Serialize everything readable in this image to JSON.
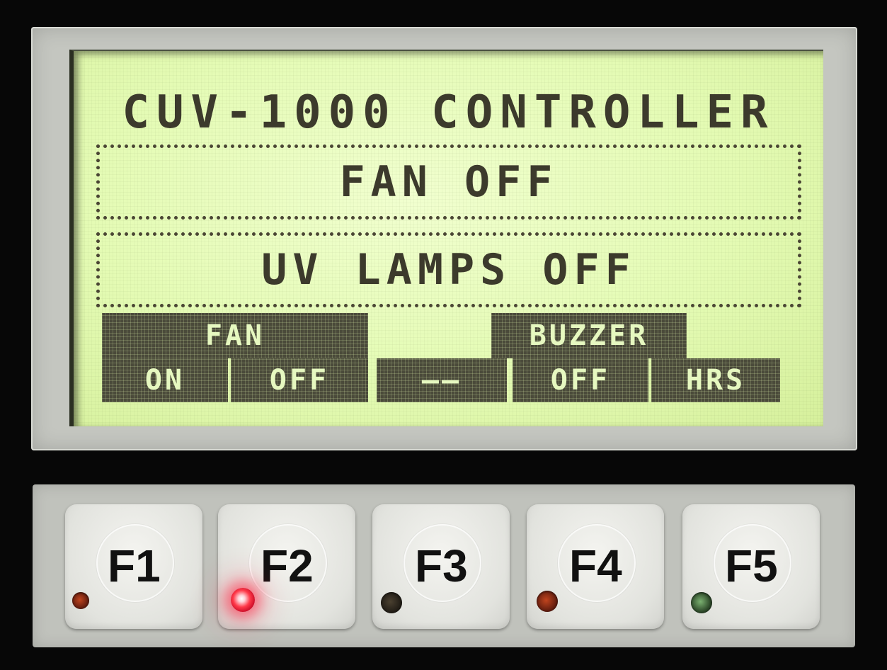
{
  "display": {
    "title": "CUV-1000 CONTROLLER",
    "fan_status": "FAN OFF",
    "uv_status": "UV LAMPS OFF",
    "softkeys": {
      "fan_title": "FAN",
      "fan_on": "ON",
      "fan_off": "OFF",
      "blank": "——",
      "buzzer_title": "BUZZER",
      "buzzer_off": "OFF",
      "hrs": "HRS"
    }
  },
  "keypad": {
    "keys": [
      {
        "label": "F1",
        "led": "off"
      },
      {
        "label": "F2",
        "led": "lit-red"
      },
      {
        "label": "F3",
        "led": "off"
      },
      {
        "label": "F4",
        "led": "off"
      },
      {
        "label": "F5",
        "led": "off"
      }
    ]
  },
  "colors": {
    "lcd_background": "#e4fbb4",
    "lcd_text": "#3c3a2c",
    "softkey_block": "#4a4a3a",
    "bezel": "#c4c6c0",
    "led_active": "#ff3a4a"
  }
}
